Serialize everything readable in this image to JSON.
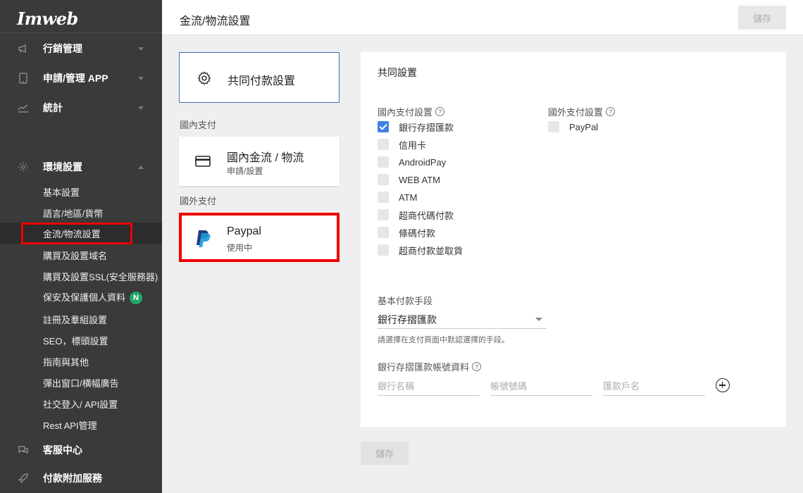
{
  "app": {
    "logo": "Imweb"
  },
  "sidebar": {
    "menus": [
      {
        "label": "行銷管理",
        "icon": "megaphone-icon"
      },
      {
        "label": "申請/管理 APP",
        "icon": "mobile-icon"
      },
      {
        "label": "統計",
        "icon": "chart-icon"
      },
      {
        "label": "環境設置",
        "icon": "gear-icon"
      },
      {
        "label": "客服中心",
        "icon": "chat-icon"
      },
      {
        "label": "付款附加服務",
        "icon": "rocket-icon"
      }
    ],
    "sub_items": [
      {
        "label": "基本設置"
      },
      {
        "label": "語言/地區/貨幣"
      },
      {
        "label": "金流/物流設置"
      },
      {
        "label": "購買及設置域名"
      },
      {
        "label": "購買及設置SSL(安全服務器)"
      },
      {
        "label": "保安及保護個人資料",
        "badge": "N"
      },
      {
        "label": "註冊及羣組設置"
      },
      {
        "label": "SEO，標頭設置"
      },
      {
        "label": "指南與其他"
      },
      {
        "label": "彈出窗口/横幅廣告"
      },
      {
        "label": "社交登入/ API設置"
      },
      {
        "label": "Rest API管理"
      }
    ]
  },
  "header": {
    "title": "金流/物流設置",
    "save_label": "儲存"
  },
  "methods": {
    "common_label": "共同付款設置",
    "domestic_section": "國內支付",
    "domestic_title": "國內金流 / 物流",
    "domestic_sub": "申請/設置",
    "overseas_section": "國外支付",
    "paypal_title": "Paypal",
    "paypal_sub": "使用中"
  },
  "panel": {
    "title": "共同設置",
    "domestic_group": "國內支付設置",
    "overseas_group": "國外支付設置",
    "domestic_options": [
      {
        "label": "銀行存摺匯款",
        "checked": true
      },
      {
        "label": "信用卡",
        "checked": false
      },
      {
        "label": "AndroidPay",
        "checked": false
      },
      {
        "label": "WEB ATM",
        "checked": false
      },
      {
        "label": "ATM",
        "checked": false
      },
      {
        "label": "超商代碼付款",
        "checked": false
      },
      {
        "label": "條碼付款",
        "checked": false
      },
      {
        "label": "超商付款並取貨",
        "checked": false
      }
    ],
    "overseas_options": [
      {
        "label": "PayPal",
        "checked": false
      }
    ],
    "default_method_label": "基本付款手段",
    "default_method_value": "銀行存摺匯款",
    "default_method_hint": "請選擇在支付頁面中默認選擇的手段。",
    "bank_info_label": "銀行存摺匯款帳號資料",
    "bank_name_placeholder": "銀行名稱",
    "account_placeholder": "帳號號碼",
    "holder_placeholder": "匯款戶名"
  },
  "footer": {
    "save_label": "儲存"
  },
  "colors": {
    "accent": "#3d82e0",
    "sidebar": "#3a3a3a",
    "highlight": "#e00000",
    "badge": "#1fa868"
  }
}
